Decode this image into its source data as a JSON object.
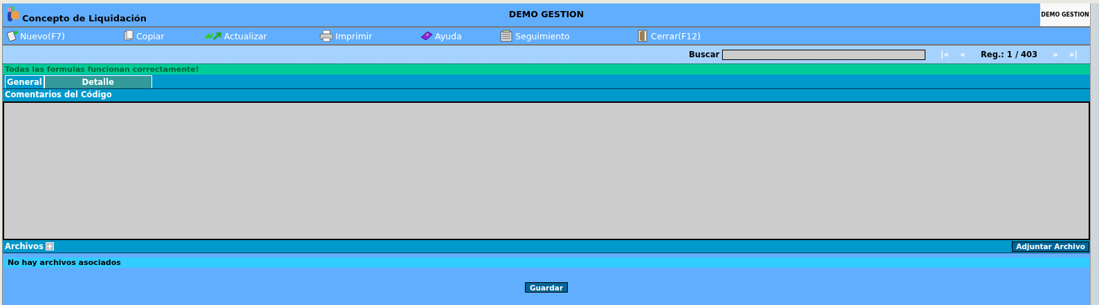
{
  "header": {
    "title": "Concepto de Liquidación",
    "company": "DEMO GESTION",
    "logo_text": "DEMO GESTION"
  },
  "toolbar": [
    {
      "label": "Nuevo(F7)",
      "kind": "new"
    },
    {
      "label": "Copiar",
      "kind": "copy"
    },
    {
      "label": "Actualizar",
      "kind": "refresh"
    },
    {
      "label": "Imprimir",
      "kind": "print"
    },
    {
      "label": "Ayuda",
      "kind": "help"
    },
    {
      "label": "Seguimiento",
      "kind": "track"
    },
    {
      "label": "Cerrar(F12)",
      "kind": "close"
    }
  ],
  "search": {
    "label": "Buscar"
  },
  "pager": {
    "first": "|«",
    "prev": "«",
    "record": "Reg.: 1 / 403",
    "next": "»",
    "last": "»|"
  },
  "status_message": "Todas las formulas funcionan correctamente!",
  "tabs": [
    {
      "label": "General",
      "selected": false
    },
    {
      "label": "Detalle",
      "selected": true
    }
  ],
  "comments": {
    "title": "Comentarios del Código"
  },
  "files": {
    "title": "Archivos",
    "attach_button": "Adjuntar Archivo",
    "empty_message": "No hay archivos asociados"
  },
  "save_button": "Guardar"
}
